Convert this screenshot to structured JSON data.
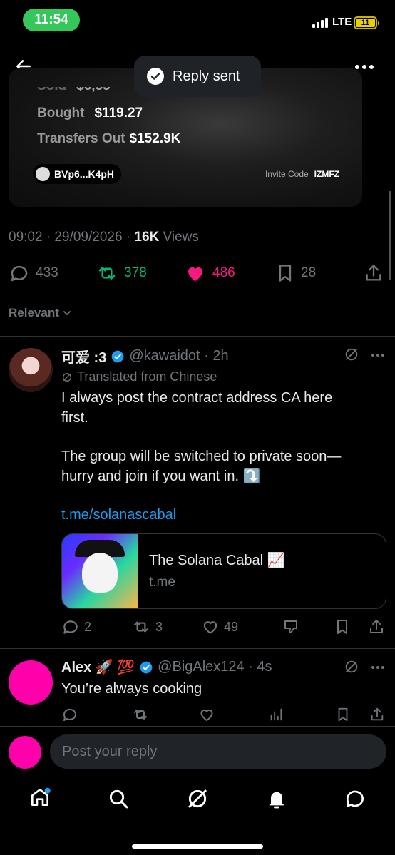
{
  "status": {
    "time": "11:54",
    "network": "LTE",
    "battery": "11"
  },
  "toast": {
    "label": "Reply sent"
  },
  "card": {
    "partial_label": "Sold",
    "partial_value": "$6,55",
    "bought_label": "Bought",
    "bought_value": "$119.27",
    "transfers_label": "Transfers Out",
    "transfers_value": "$152.9K",
    "address": "BVp6...K4pH",
    "invite_label": "Invite Code",
    "invite_code": "IZMFZ"
  },
  "post_meta": {
    "time": "09:02 · 29/09/2026 · ",
    "views_count": "16K",
    "views_label": " Views"
  },
  "post_actions": {
    "replies": "433",
    "reposts": "378",
    "likes": "486",
    "bookmarks": "28"
  },
  "sort": {
    "label": "Relevant"
  },
  "reply1": {
    "name": "可爱 :3",
    "handle": "@kawaidot · 2h",
    "translated": "Translated from Chinese",
    "line1": "I always post the contract address CA here",
    "line2": "first.",
    "line3": "The group will be switched to private soon—",
    "line4": "hurry and join if you want in. ⤵️",
    "link": "t.me/solanascabal",
    "card_title": "The Solana Cabal 📈",
    "card_domain": "t.me",
    "replies": "2",
    "reposts": "3",
    "likes": "49"
  },
  "reply2": {
    "name": "Alex 🚀 💯",
    "handle": "@BigAlex124 · 4s",
    "text": "You’re always cooking"
  },
  "composer": {
    "placeholder": "Post your reply"
  },
  "colors": {
    "accent": "#1d9bf0",
    "like": "#f91880",
    "repost": "#00ba7c",
    "avatar_pink": "#ff00aa"
  }
}
